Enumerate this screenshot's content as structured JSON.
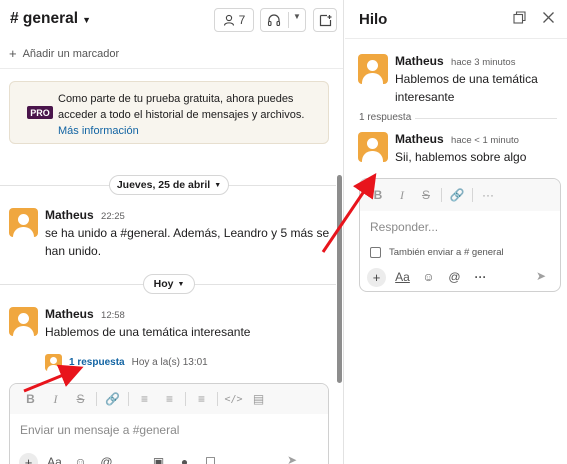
{
  "channel": {
    "name": "# general",
    "member_count": "7",
    "bookmark_label": "Añadir un marcador"
  },
  "trial_banner": {
    "badge": "PRO",
    "text": "Como parte de tu prueba gratuita, ahora puedes acceder a todo el historial de mensajes y archivos.",
    "link": "Más información"
  },
  "dividers": {
    "date1": "Jueves, 25 de abril",
    "date2": "Hoy"
  },
  "messages": [
    {
      "author": "Matheus",
      "time": "22:25",
      "text": "se ha unido a #general. Además, Leandro y 5 más se han unido."
    },
    {
      "author": "Matheus",
      "time": "12:58",
      "text": "Hablemos de una temática interesante",
      "replies_label": "1 respuesta",
      "replies_time": "Hoy a la(s) 13:01"
    }
  ],
  "composer": {
    "placeholder": "Enviar un mensaje a #general"
  },
  "thread": {
    "title": "Hilo",
    "parent": {
      "author": "Matheus",
      "time": "hace 3 minutos",
      "text": "Hablemos de una temática interesante"
    },
    "reply_count": "1 respuesta",
    "reply": {
      "author": "Matheus",
      "time": "hace < 1 minuto",
      "text": "Sii, hablemos sobre algo"
    },
    "composer_placeholder": "Responder...",
    "also_send": "También enviar a # general"
  },
  "colors": {
    "accent_link": "#1264a3",
    "pro_badge": "#4a154b",
    "avatar": "#f0a73f",
    "annotation_arrow": "#e8141c"
  }
}
